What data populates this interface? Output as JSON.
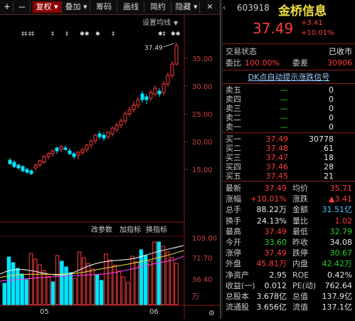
{
  "toolbar": {
    "plus": "+",
    "minus": "—",
    "adjust": "复权",
    "overlay": "叠加",
    "chips": "筹码",
    "draw": "画线",
    "brief": "简约",
    "hide": "隐藏",
    "close": "✕"
  },
  "chart": {
    "settings_label": "设置均线",
    "price_marker": "37.49",
    "price_ticks": [
      "35.00",
      "30.00",
      "25.00",
      "20.00",
      "15.00"
    ],
    "vol_ticks": [
      "109.00",
      "71.70",
      "36.40",
      "万"
    ],
    "indicator_tabs": [
      "改参数",
      "加指标",
      "换指标"
    ],
    "months": [
      "05",
      "06"
    ],
    "event_markers": [
      "‡‡",
      "‡‡",
      "‡",
      "‡",
      "✱✱",
      "✱",
      "‡",
      "✱‡",
      "✱✱"
    ]
  },
  "quote": {
    "code": "603918",
    "name": "金桥信息",
    "price": "37.49",
    "change": "+3.41",
    "change_pct": "+10.01%"
  },
  "status": {
    "trade_state_label": "交易状态",
    "trade_state_value": "已收市",
    "ratio_label": "委比",
    "ratio_value": "100.00%",
    "diff_label": "委差",
    "diff_value": "30906"
  },
  "banner": "DK点自动提示涨跌信号",
  "sell_orders": [
    {
      "label": "卖五",
      "price": "—",
      "volume": "0"
    },
    {
      "label": "卖四",
      "price": "—",
      "volume": "0"
    },
    {
      "label": "卖三",
      "price": "—",
      "volume": "0"
    },
    {
      "label": "卖二",
      "price": "—",
      "volume": "0"
    },
    {
      "label": "卖一",
      "price": "—",
      "volume": "0"
    }
  ],
  "buy_orders": [
    {
      "label": "买一",
      "price": "37.49",
      "volume": "30778"
    },
    {
      "label": "买二",
      "price": "37.48",
      "volume": "61"
    },
    {
      "label": "买三",
      "price": "37.47",
      "volume": "18"
    },
    {
      "label": "买四",
      "price": "37.46",
      "volume": "28"
    },
    {
      "label": "买五",
      "price": "37.45",
      "volume": "21"
    }
  ],
  "stats": [
    {
      "l1": "最新",
      "v1": "37.49",
      "c1": "red",
      "l2": "均价",
      "v2": "35.71",
      "c2": "red"
    },
    {
      "l1": "涨幅",
      "v1": "+10.01%",
      "c1": "red",
      "l2": "涨跌",
      "v2": "▲3.41",
      "c2": "red"
    },
    {
      "l1": "总手",
      "v1": "88.22万",
      "c1": "white",
      "l2": "金额",
      "v2": "31.51亿",
      "c2": "cyan"
    },
    {
      "l1": "换手",
      "v1": "24.13%",
      "c1": "white",
      "l2": "量比",
      "v2": "1.02",
      "c2": "red"
    },
    {
      "l1": "最高",
      "v1": "37.49",
      "c1": "red",
      "l2": "最低",
      "v2": "32.79",
      "c2": "green"
    },
    {
      "l1": "今开",
      "v1": "33.60",
      "c1": "green",
      "l2": "昨收",
      "v2": "34.08",
      "c2": "white"
    },
    {
      "l1": "涨停",
      "v1": "37.49",
      "c1": "red",
      "l2": "跌停",
      "v2": "30.67",
      "c2": "green"
    },
    {
      "l1": "外盘",
      "v1": "45.81万",
      "c1": "red",
      "l2": "内盘",
      "v2": "42.42万",
      "c2": "green"
    },
    {
      "l1": "净资产",
      "v1": "2.95",
      "c1": "white",
      "l2": "ROE",
      "v2": "0.42%",
      "c2": "white"
    },
    {
      "l1": "收益(一)",
      "v1": "0.012",
      "c1": "white",
      "l2": "PE(动)",
      "v2": "762.64",
      "c2": "white"
    },
    {
      "l1": "总股本",
      "v1": "3.678亿",
      "c1": "white",
      "l2": "总值",
      "v2": "137.9亿",
      "c2": "white"
    },
    {
      "l1": "流通股",
      "v1": "3.656亿",
      "c1": "white",
      "l2": "流值",
      "v2": "137.1亿",
      "c2": "white"
    }
  ],
  "colors": {
    "up": "#ff3b3b",
    "down": "#00e5ff",
    "ma5": "#ffffff",
    "ma10": "#f0e040",
    "ma20": "#ff40ff"
  }
}
